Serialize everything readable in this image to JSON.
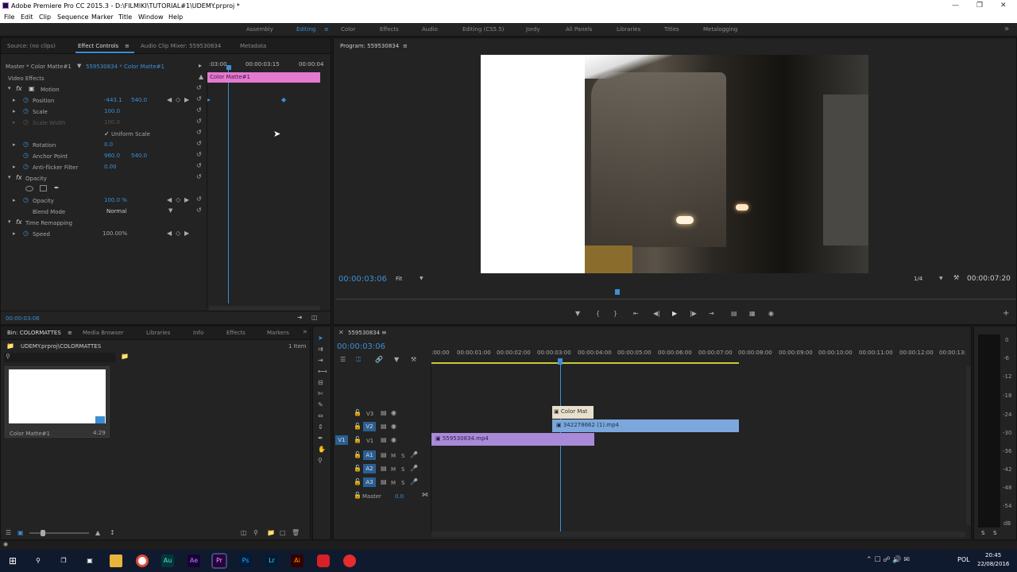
{
  "titlebar": {
    "title": "Adobe Premiere Pro CC 2015.3 - D:\\FILMIKI\\TUTORIAL#1\\UDEMY.prproj *"
  },
  "menu": [
    "File",
    "Edit",
    "Clip",
    "Sequence",
    "Marker",
    "Title",
    "Window",
    "Help"
  ],
  "workspaces": [
    {
      "label": "Assembly",
      "active": false
    },
    {
      "label": "Editing",
      "active": true
    },
    {
      "label": "Color",
      "active": false
    },
    {
      "label": "Effects",
      "active": false
    },
    {
      "label": "Audio",
      "active": false
    },
    {
      "label": "Editing (CS5.5)",
      "active": false
    },
    {
      "label": "Jordy",
      "active": false
    },
    {
      "label": "All Panels",
      "active": false
    },
    {
      "label": "Libraries",
      "active": false
    },
    {
      "label": "Titles",
      "active": false
    },
    {
      "label": "Metalogging",
      "active": false
    }
  ],
  "source_tabs": [
    "Source: (no clips)",
    "Effect Controls",
    "Audio Clip Mixer: 559530834",
    "Metadata"
  ],
  "effect_controls": {
    "master": "Master * Color Matte#1",
    "clip": "559530834 * Color Matte#1",
    "ruler": [
      ":03:00",
      "00:00:03:15",
      "00:00:04"
    ],
    "clip_bar": "Color Matte#1",
    "section": "Video Effects",
    "rows": {
      "motion": "Motion",
      "position": "Position",
      "pos_x": "-443.1",
      "pos_y": "540.0",
      "scale": "Scale",
      "scale_v": "100.0",
      "scale_width": "Scale Width",
      "scale_width_v": "100.0",
      "uniform": "Uniform Scale",
      "rotation": "Rotation",
      "rotation_v": "0.0",
      "anchor": "Anchor Point",
      "anchor_x": "960.0",
      "anchor_y": "540.0",
      "antiflicker": "Anti-flicker Filter",
      "antiflicker_v": "0.00",
      "opacity_fx": "Opacity",
      "opacity": "Opacity",
      "opacity_v": "100.0 %",
      "blend": "Blend Mode",
      "blend_v": "Normal",
      "remap": "Time Remapping",
      "speed": "Speed",
      "speed_v": "100.00%"
    },
    "timecode": "00:00:03:06"
  },
  "program": {
    "title": "Program: 559530834",
    "timecode": "00:00:03:06",
    "fit": "Fit",
    "quality": "1/4",
    "duration": "00:00:07:20"
  },
  "project": {
    "tabs": [
      "Bin: COLORMATTES",
      "Media Browser",
      "Libraries",
      "Info",
      "Effects",
      "Markers"
    ],
    "path": "UDEMY.prproj\\COLORMATTES",
    "count": "1 Item",
    "item_name": "Color Matte#1",
    "item_dur": "4:29"
  },
  "timeline": {
    "tab": "559530834",
    "timecode": "00:00:03:06",
    "ruler": [
      ":00:00",
      "00:00:01:00",
      "00:00:02:00",
      "00:00:03:00",
      "00:00:04:00",
      "00:00:05:00",
      "00:00:06:00",
      "00:00:07:00",
      "00:00:08:00",
      "00:00:09:00",
      "00:00:10:00",
      "00:00:11:00",
      "00:00:12:00",
      "00:00:13:"
    ],
    "tracks": [
      "V3",
      "V2",
      "V1",
      "A1",
      "A2",
      "A3"
    ],
    "src_v1": "V1",
    "master": "Master",
    "master_val": "0.0",
    "clips": {
      "v3": "Color Mat",
      "v2": "342278662 (1).mp4",
      "v1": "559530834.mp4"
    }
  },
  "meter_scale": [
    "0",
    "-6",
    "-12",
    "-18",
    "-24",
    "-30",
    "-36",
    "-42",
    "-48",
    "-54",
    "dB"
  ],
  "meter_solo": [
    "S",
    "S"
  ],
  "taskbar": {
    "lang": "POL",
    "time": "20:45",
    "date": "22/08/2016"
  },
  "colors": {
    "accent": "#3b8fd6",
    "clip_pink": "#e37ad0",
    "clip_blue": "#7ba7dc",
    "clip_purple": "#a88ad8"
  }
}
